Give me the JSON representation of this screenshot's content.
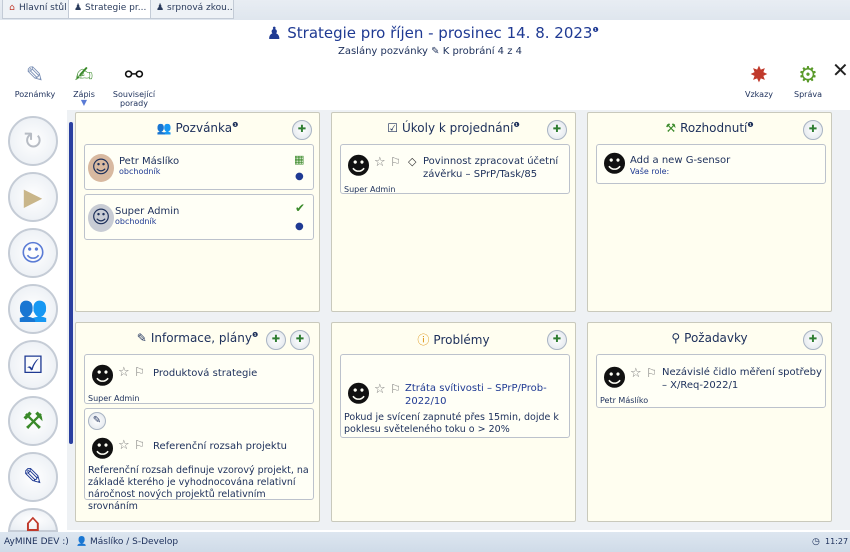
{
  "tabs": [
    {
      "label": "Hlavní stůl",
      "icon": "home-icon"
    },
    {
      "label": "Strategie pr...",
      "icon": "meeting-icon"
    },
    {
      "label": "srpnová zkou...",
      "icon": "meeting-icon"
    }
  ],
  "header": {
    "title": "Strategie pro říjen - prosinec 14. 8. 2023",
    "info_mark": "❶",
    "subtitle": "Zaslány pozvánky ✎ K probrání 4 z 4"
  },
  "toolbar": {
    "notes": "Poznámky",
    "minutes": "Zápis",
    "related": "Související porady",
    "messages": "Vzkazy",
    "admin": "Správa"
  },
  "panels": {
    "invitation": {
      "title": "Pozvánka",
      "people": [
        {
          "name": "Petr Máslíko",
          "role": "obchodník"
        },
        {
          "name": "Super Admin",
          "role": "obchodník"
        }
      ]
    },
    "tasks": {
      "title": "Úkoly k projednání",
      "items": [
        {
          "text": "Povinnost zpracovat účetní závěrku – SPrP/Task/85",
          "author": "Super Admin"
        }
      ]
    },
    "decision": {
      "title": "Rozhodnutí",
      "items": [
        {
          "text": "Add a new G-sensor",
          "role_label": "Vaše role:"
        }
      ]
    },
    "info": {
      "title": "Informace, plány",
      "items": [
        {
          "text": "Produktová strategie",
          "author": "Super Admin"
        },
        {
          "text": "Referenční rozsah projektu",
          "desc": "Referenční rozsah definuje vzorový projekt, na základě kterého je vyhodnocována relativní náročnost nových projektů relativním srovnáním"
        }
      ]
    },
    "problems": {
      "title": "Problémy",
      "items": [
        {
          "text": "Ztráta svítivosti – SPrP/Prob-2022/10",
          "desc": "Pokud je svícení zapnuté přes 15min, dojde k poklesu světeleného toku o > 20%"
        }
      ]
    },
    "requests": {
      "title": "Požadavky",
      "items": [
        {
          "text": "Nezávislé čidlo měření spotřeby – X/Req-2022/1",
          "author": "Petr Máslíko"
        }
      ]
    }
  },
  "status": {
    "app": "AyMINE DEV :)",
    "user": "Máslíko / S-Develop",
    "time": "11:27"
  },
  "colors": {
    "accent": "#1f3a93",
    "panel_bg": "#fffef0",
    "bar": "#2a3fa0"
  }
}
